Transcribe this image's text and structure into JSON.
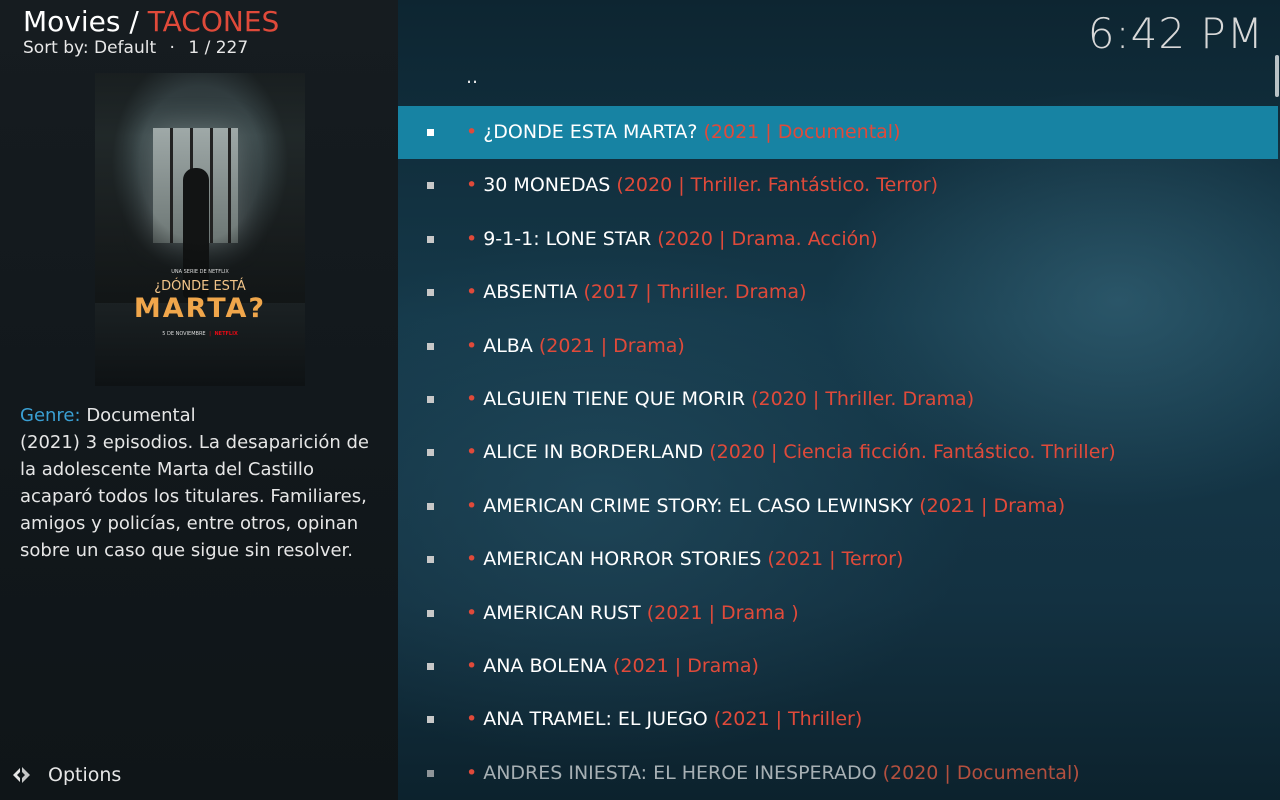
{
  "header": {
    "section": "Movies",
    "separator": " / ",
    "folder": "TACONES",
    "sort_label": "Sort by: Default",
    "bullet": "·",
    "position": "1 / 227",
    "clock": "6:42 PM"
  },
  "poster": {
    "tagline": "UNA SERIE DE NETFLIX",
    "title_line1": "¿DÓNDE ESTÁ",
    "title_line2": "MARTA?",
    "release": "5 DE NOVIEMBRE",
    "brand": "NETFLIX"
  },
  "info": {
    "genre_label": "Genre:",
    "genre_value": "Documental",
    "plot": "(2021) 3 episodios. La desaparición de la adolescente Marta del Castillo acaparó todos los titulares. Familiares, amigos y policías, entre otros, opinan sobre un caso que sigue sin resolver."
  },
  "options_label": "Options",
  "parent_item": "..",
  "list": [
    {
      "title": "¿DONDE ESTA MARTA?",
      "meta": "(2021 | Documental)"
    },
    {
      "title": "30 MONEDAS",
      "meta": "(2020 | Thriller. Fantástico. Terror)"
    },
    {
      "title": "9-1-1: LONE STAR",
      "meta": "(2020 | Drama. Acción)"
    },
    {
      "title": "ABSENTIA",
      "meta": "(2017 | Thriller. Drama)"
    },
    {
      "title": "ALBA",
      "meta": "(2021 | Drama)"
    },
    {
      "title": "ALGUIEN TIENE QUE MORIR",
      "meta": "(2020 | Thriller. Drama)"
    },
    {
      "title": "ALICE IN BORDERLAND",
      "meta": "(2020 | Ciencia ficción. Fantástico. Thriller)"
    },
    {
      "title": "AMERICAN CRIME STORY:  EL CASO LEWINSKY",
      "meta": "(2021 | Drama)"
    },
    {
      "title": "AMERICAN HORROR STORIES",
      "meta": "(2021 | Terror)"
    },
    {
      "title": "AMERICAN RUST",
      "meta": "(2021 | Drama )"
    },
    {
      "title": "ANA BOLENA",
      "meta": "(2021 | Drama)"
    },
    {
      "title": "ANA TRAMEL: EL JUEGO",
      "meta": "(2021 | Thriller)"
    },
    {
      "title": "ANDRES INIESTA: EL HEROE INESPERADO",
      "meta": "(2020 | Documental)"
    }
  ],
  "bullet_dot": "•",
  "colors": {
    "accent": "#e04a3a",
    "selection": "#1783a3",
    "genre_label": "#3a9fd3"
  }
}
